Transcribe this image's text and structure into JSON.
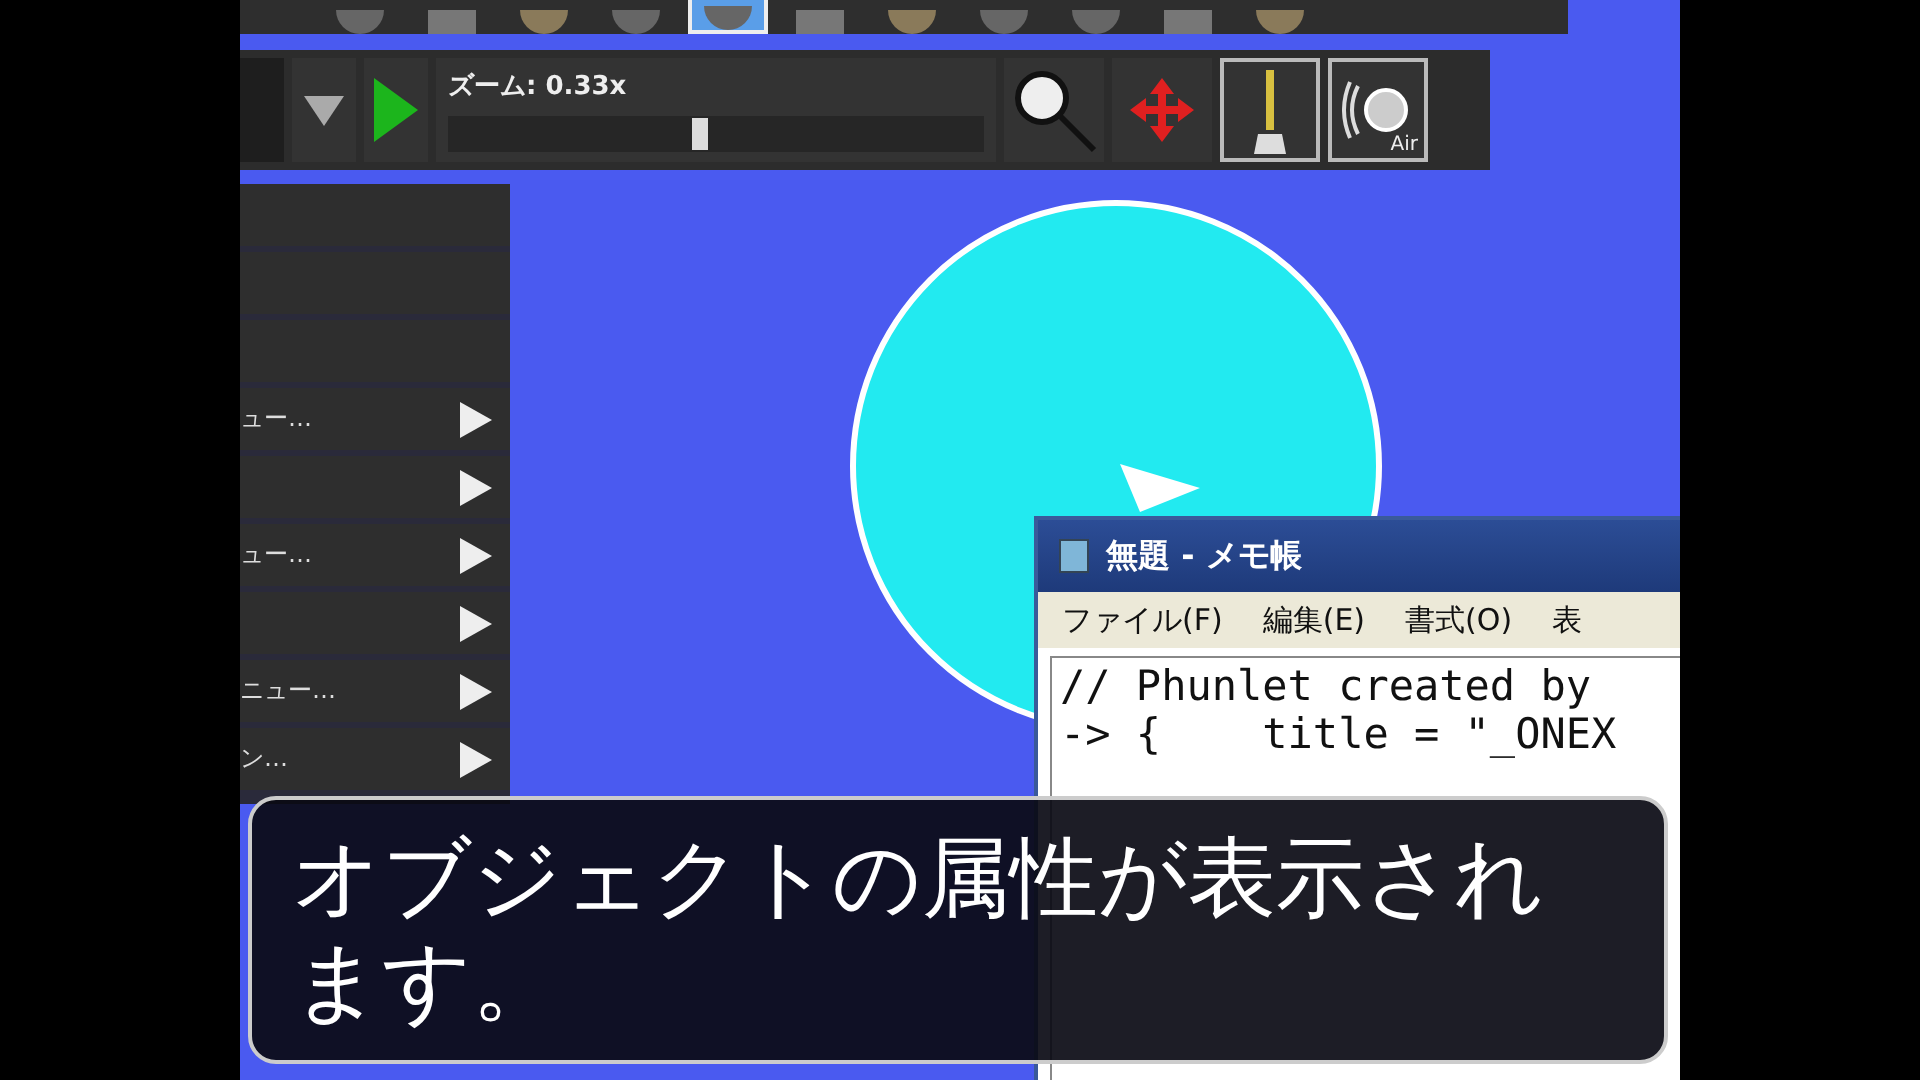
{
  "top_toolbar": {
    "tools": [
      {
        "selected": false
      },
      {
        "selected": false
      },
      {
        "selected": false
      },
      {
        "selected": false
      },
      {
        "selected": true
      },
      {
        "selected": false
      },
      {
        "selected": false
      },
      {
        "selected": false
      },
      {
        "selected": false
      },
      {
        "selected": false
      },
      {
        "selected": false
      }
    ]
  },
  "control_bar": {
    "zoom_label": "ズーム: 0.33x",
    "zoom_slider": {
      "level": 0.47
    },
    "toggles": [
      {
        "kind": "lamp",
        "on": true
      },
      {
        "kind": "air",
        "on": true,
        "label": "Air"
      }
    ]
  },
  "side_menu": {
    "items": [
      {
        "kind": "labelled",
        "label": "ュー…"
      },
      {
        "kind": "arrow"
      },
      {
        "kind": "labelled",
        "label": "ュー…"
      },
      {
        "kind": "arrow"
      },
      {
        "kind": "labelled",
        "label": "ニュー…"
      },
      {
        "kind": "labelled",
        "label": "ン…"
      }
    ]
  },
  "notepad": {
    "title": "無題 - メモ帳",
    "menu": [
      "ファイル(F)",
      "編集(E)",
      "書式(O)",
      "表"
    ],
    "lines": [
      "// Phunlet created by",
      "-> {    title = \"_ONEX"
    ]
  },
  "subtitle": "オブジェクトの属性が表示されます。"
}
